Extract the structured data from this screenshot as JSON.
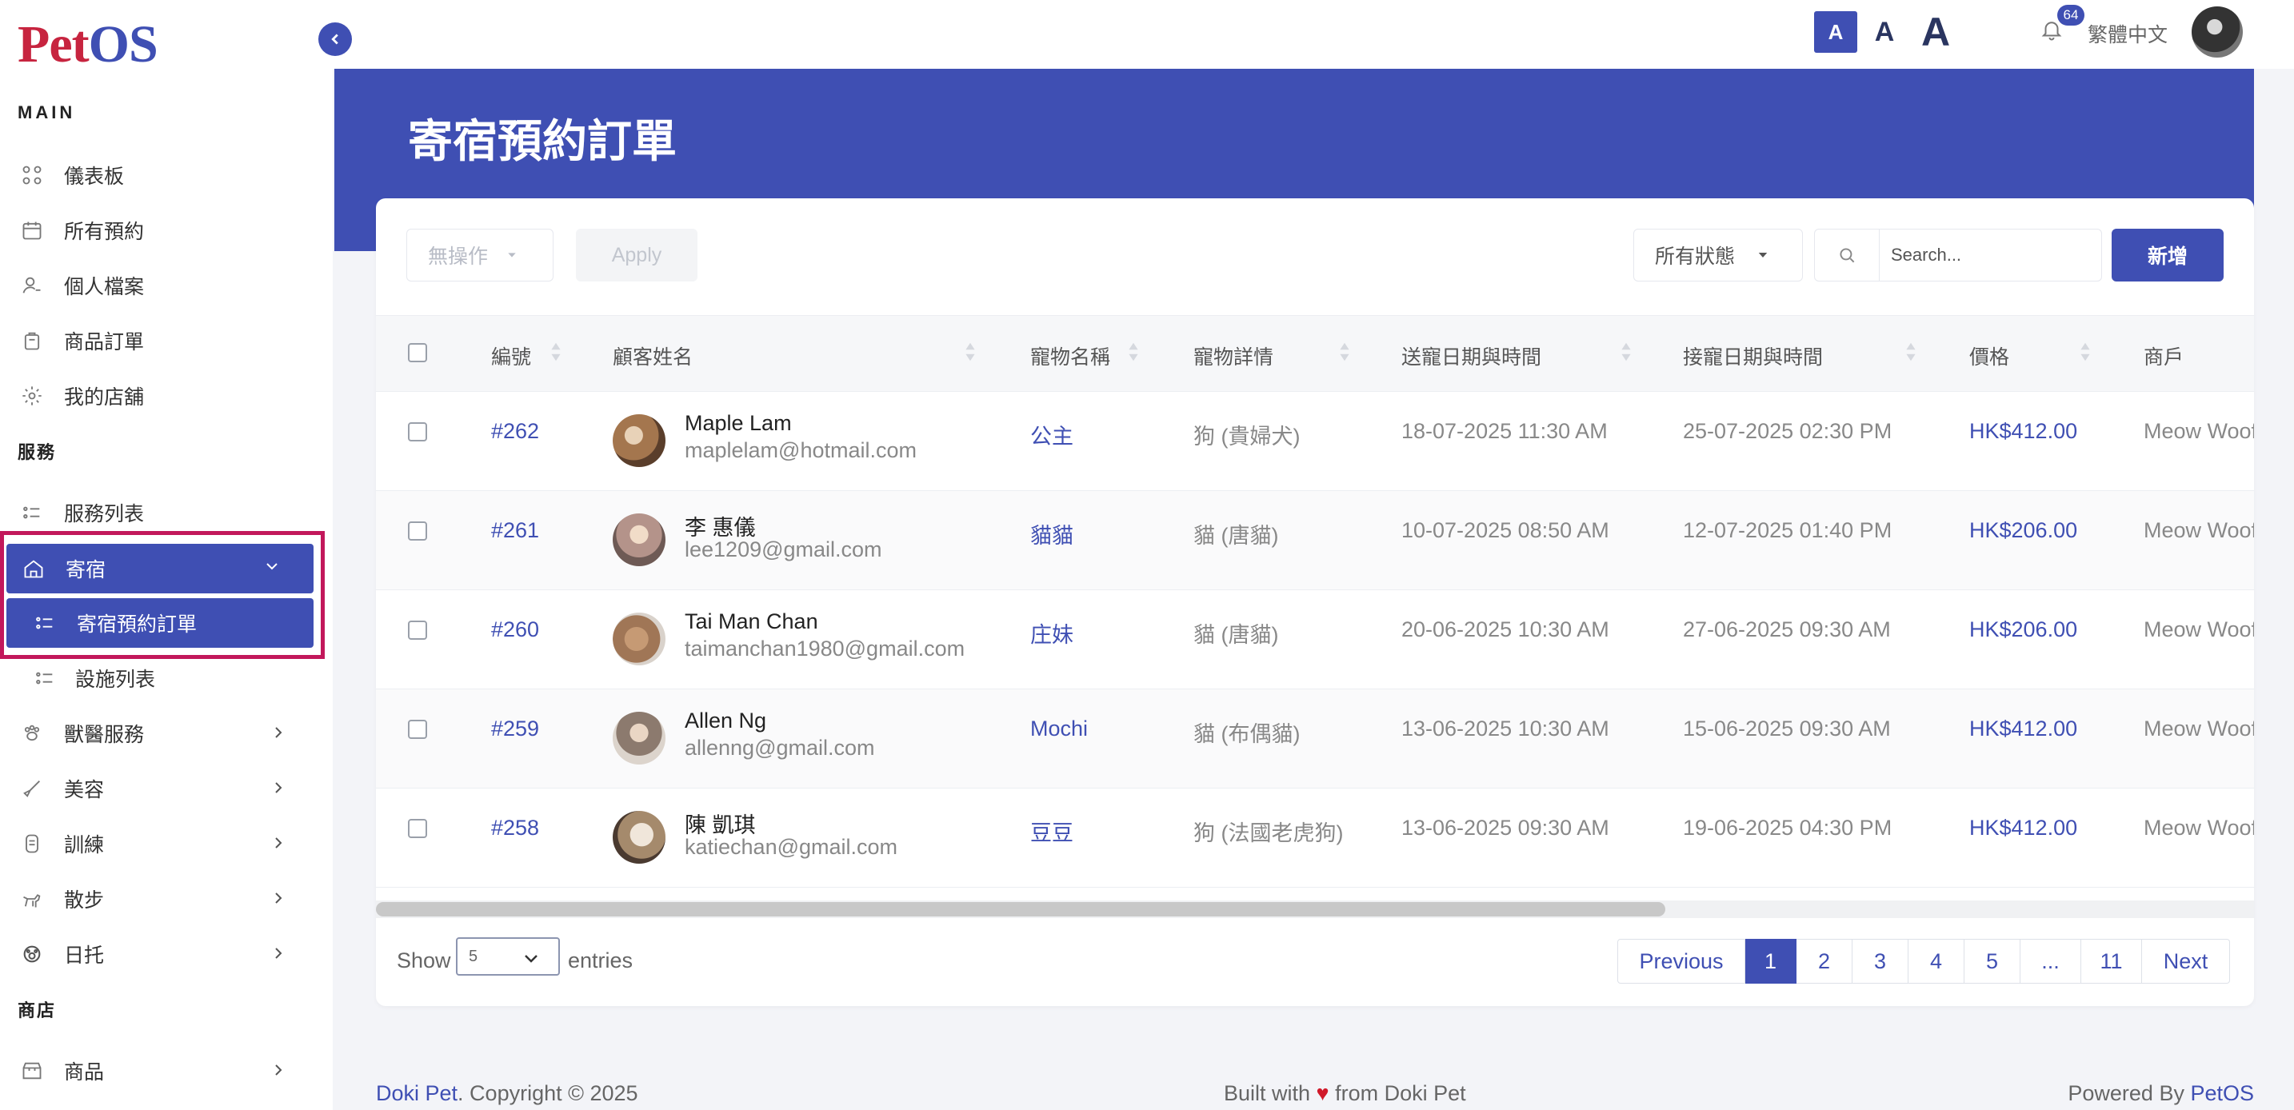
{
  "brand": {
    "logo_p1": "P",
    "logo_p2": "et",
    "logo_p3": "OS"
  },
  "sidebar": {
    "section_main": "MAIN",
    "section_services": "服務",
    "section_shop": "商店",
    "items": [
      {
        "label": "儀表板",
        "icon": "grid-icon"
      },
      {
        "label": "所有預約",
        "icon": "calendar-icon"
      },
      {
        "label": "個人檔案",
        "icon": "user-icon"
      },
      {
        "label": "商品訂單",
        "icon": "bag-icon"
      },
      {
        "label": "我的店舖",
        "icon": "store-gear-icon"
      },
      {
        "label": "服務列表",
        "icon": "list-icon"
      },
      {
        "label": "寄宿",
        "icon": "home-icon"
      },
      {
        "label": "寄宿預約訂單",
        "icon": "list-icon"
      },
      {
        "label": "設施列表",
        "icon": "list-icon"
      },
      {
        "label": "獸醫服務",
        "icon": "paw-icon"
      },
      {
        "label": "美容",
        "icon": "brush-icon"
      },
      {
        "label": "訓練",
        "icon": "training-icon"
      },
      {
        "label": "散步",
        "icon": "dog-walk-icon"
      },
      {
        "label": "日托",
        "icon": "paw-sun-icon"
      },
      {
        "label": "商品",
        "icon": "shop-icon"
      }
    ]
  },
  "topbar": {
    "font_small": "A",
    "font_medium": "A",
    "font_large": "A",
    "notif_count": "64",
    "language": "繁體中文"
  },
  "page": {
    "title": "寄宿預約訂單"
  },
  "toolbar": {
    "bulk_action": "無操作",
    "apply": "Apply",
    "status_filter": "所有狀態",
    "search_placeholder": "Search...",
    "add": "新增"
  },
  "table": {
    "headers": [
      "編號",
      "顧客姓名",
      "寵物名稱",
      "寵物詳情",
      "送寵日期與時間",
      "接寵日期與時間",
      "價格",
      "商戶"
    ],
    "rows": [
      {
        "id": "#262",
        "name": "Maple Lam",
        "email": "maplelam@hotmail.com",
        "pet": "公主",
        "detail": "狗 (貴婦犬)",
        "dropoff": "18-07-2025 11:30 AM",
        "pickup": "25-07-2025 02:30 PM",
        "price": "HK$412.00",
        "merchant": "Meow Woof"
      },
      {
        "id": "#261",
        "name": "李 惠儀",
        "email": "lee1209@gmail.com",
        "pet": "貓貓",
        "detail": "貓 (唐貓)",
        "dropoff": "10-07-2025 08:50 AM",
        "pickup": "12-07-2025 01:40 PM",
        "price": "HK$206.00",
        "merchant": "Meow Woof"
      },
      {
        "id": "#260",
        "name": "Tai Man Chan",
        "email": "taimanchan1980@gmail.com",
        "pet": "庄妹",
        "detail": "貓 (唐貓)",
        "dropoff": "20-06-2025 10:30 AM",
        "pickup": "27-06-2025 09:30 AM",
        "price": "HK$206.00",
        "merchant": "Meow Woof"
      },
      {
        "id": "#259",
        "name": "Allen Ng",
        "email": "allenng@gmail.com",
        "pet": "Mochi",
        "detail": "貓 (布偶貓)",
        "dropoff": "13-06-2025 10:30 AM",
        "pickup": "15-06-2025 09:30 AM",
        "price": "HK$412.00",
        "merchant": "Meow Woof"
      },
      {
        "id": "#258",
        "name": "陳 凱琪",
        "email": "katiechan@gmail.com",
        "pet": "豆豆",
        "detail": "狗 (法國老虎狗)",
        "dropoff": "13-06-2025 09:30 AM",
        "pickup": "19-06-2025 04:30 PM",
        "price": "HK$412.00",
        "merchant": "Meow Woof"
      }
    ]
  },
  "pagination": {
    "show_label": "Show",
    "entries_value": "5",
    "entries_label": "entries",
    "previous": "Previous",
    "pages": [
      "1",
      "2",
      "3",
      "4",
      "5",
      "...",
      "11"
    ],
    "next": "Next",
    "current": "1"
  },
  "footer": {
    "left_brand": "Doki Pet",
    "left_text": ". Copyright © 2025",
    "mid_text1": "Built with ",
    "mid_heart": "♥",
    "mid_text2": " from Doki Pet",
    "right_text": "Powered By ",
    "right_brand": "PetOS"
  },
  "colors": {
    "primary": "#3f4fb3",
    "highlight": "#c2185b",
    "logo_red": "#c7243f"
  }
}
